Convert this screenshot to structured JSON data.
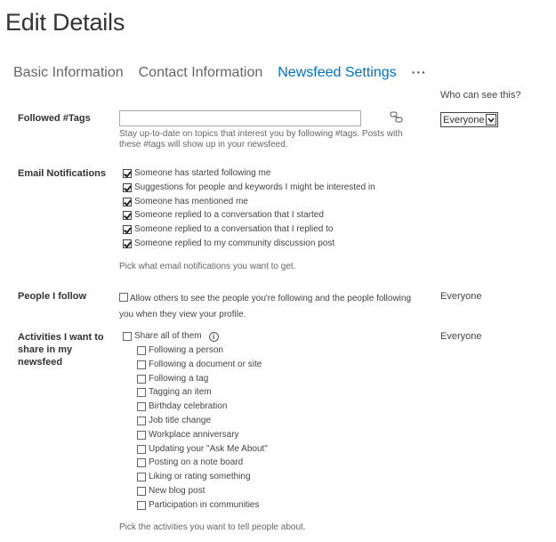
{
  "page": {
    "title": "Edit Details"
  },
  "tabs": [
    {
      "label": "Basic Information"
    },
    {
      "label": "Contact Information"
    },
    {
      "label": "Newsfeed Settings"
    }
  ],
  "tabs_more": "···",
  "visibility": {
    "header": "Who can see this?"
  },
  "tags": {
    "label": "Followed #Tags",
    "value": "",
    "help": "Stay up-to-date on topics that interest you by following #tags. Posts with these #tags will show up in your newsfeed.",
    "visibility": "Everyone"
  },
  "email": {
    "label": "Email Notifications",
    "items": [
      {
        "label": "Someone has started following me",
        "checked": true
      },
      {
        "label": "Suggestions for people and keywords I might be interested in",
        "checked": true
      },
      {
        "label": "Someone has mentioned me",
        "checked": true
      },
      {
        "label": "Someone replied to a conversation that I started",
        "checked": true
      },
      {
        "label": "Someone replied to a conversation that I replied to",
        "checked": true
      },
      {
        "label": "Someone replied to my community discussion post",
        "checked": true
      }
    ],
    "help": "Pick what email notifications you want to get."
  },
  "people": {
    "label": "People I follow",
    "text": "Allow others to see the people you're following and the people following you when they view your profile.",
    "checked": false,
    "visibility": "Everyone"
  },
  "activities": {
    "label": "Activities I want to share in my newsfeed",
    "share_all": "Share all of them",
    "info_icon": "i",
    "visibility": "Everyone",
    "items": [
      {
        "label": "Following a person",
        "checked": false
      },
      {
        "label": "Following a document or site",
        "checked": false
      },
      {
        "label": "Following a tag",
        "checked": false
      },
      {
        "label": "Tagging an item",
        "checked": false
      },
      {
        "label": "Birthday celebration",
        "checked": false
      },
      {
        "label": "Job title change",
        "checked": false
      },
      {
        "label": "Workplace anniversary",
        "checked": false
      },
      {
        "label": "Updating your \"Ask Me About\"",
        "checked": false
      },
      {
        "label": "Posting on a note board",
        "checked": false
      },
      {
        "label": "Liking or rating something",
        "checked": false
      },
      {
        "label": "New blog post",
        "checked": false
      },
      {
        "label": "Participation in communities",
        "checked": false
      }
    ],
    "help": "Pick the activities you want to tell people about."
  },
  "colors": {
    "accent": "#0072c6",
    "text": "#444444"
  }
}
